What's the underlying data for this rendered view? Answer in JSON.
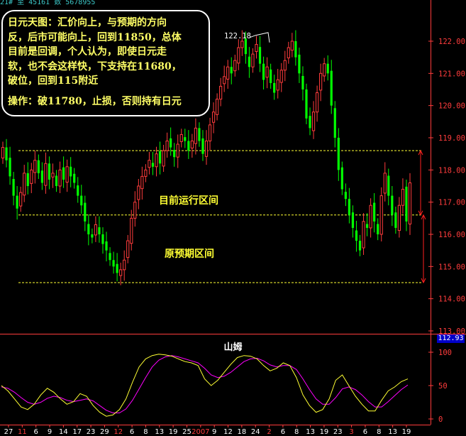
{
  "header_fragment": "21# 至 45161 数 5678955",
  "annotation": {
    "lines": [
      "日元天图：汇价向上，与预期的方向",
      "反，后市可能向上，回到11850，总体",
      "目前是回调，个人认为，即使日元走",
      "软，也不会这样快，下支持在11680，",
      "破位，回到115附近"
    ],
    "operation": "操作：破11780，止损，否则持有日元"
  },
  "zone_labels": {
    "current": "目前运行区间",
    "original": "原预期区间"
  },
  "indicator": {
    "title": "山姆",
    "current_value_box": "112.93",
    "ticks": [
      "100",
      "50",
      "0"
    ]
  },
  "colors": {
    "up": "#ff3c3c",
    "down": "#00ff00",
    "dash": "#ffff33",
    "arrow": "#ff2020",
    "axis": "#ff3c3c",
    "k_line": "#ffff33",
    "d_line": "#ff00ff"
  },
  "chart_data": {
    "type": "candlestick",
    "y_ticks": [
      "122.00",
      "121.00",
      "120.00",
      "119.00",
      "118.00",
      "117.00",
      "116.00",
      "115.00",
      "114.00",
      "113.00"
    ],
    "ylim": [
      113.0,
      122.6
    ],
    "high_annotation": "122.18",
    "support_levels": [
      118.6,
      116.6,
      114.5
    ],
    "x_tick_labels": [
      {
        "t": "27",
        "c": "w"
      },
      {
        "t": "11",
        "c": "r"
      },
      {
        "t": "6",
        "c": "w"
      },
      {
        "t": "9",
        "c": "w"
      },
      {
        "t": "14",
        "c": "w"
      },
      {
        "t": "17",
        "c": "w"
      },
      {
        "t": "23",
        "c": "w"
      },
      {
        "t": "29",
        "c": "w"
      },
      {
        "t": "12",
        "c": "r"
      },
      {
        "t": "6",
        "c": "w"
      },
      {
        "t": "8",
        "c": "w"
      },
      {
        "t": "13",
        "c": "w"
      },
      {
        "t": "19",
        "c": "w"
      },
      {
        "t": "25",
        "c": "w"
      },
      {
        "t": "2007",
        "c": "r"
      },
      {
        "t": "9",
        "c": "w"
      },
      {
        "t": "12",
        "c": "w"
      },
      {
        "t": "18",
        "c": "w"
      },
      {
        "t": "24",
        "c": "w"
      },
      {
        "t": "2",
        "c": "r"
      },
      {
        "t": "6",
        "c": "w"
      },
      {
        "t": "8",
        "c": "w"
      },
      {
        "t": "13",
        "c": "w"
      },
      {
        "t": "19",
        "c": "w"
      },
      {
        "t": "23",
        "c": "w"
      },
      {
        "t": "3",
        "c": "r"
      },
      {
        "t": "6",
        "c": "w"
      },
      {
        "t": "8",
        "c": "w"
      },
      {
        "t": "13",
        "c": "w"
      },
      {
        "t": "19",
        "c": "w"
      }
    ],
    "closes": [
      118.7,
      118.3,
      117.8,
      117.2,
      116.8,
      117.3,
      117.9,
      117.5,
      118.0,
      118.3,
      117.9,
      117.6,
      118.2,
      117.7,
      117.9,
      117.5,
      118.0,
      117.7,
      118.1,
      117.8,
      117.6,
      117.2,
      116.9,
      116.4,
      116.0,
      115.9,
      116.3,
      116.0,
      115.7,
      115.5,
      115.2,
      115.0,
      114.8,
      114.9,
      115.2,
      115.8,
      116.5,
      117.0,
      117.5,
      117.8,
      118.0,
      118.3,
      118.1,
      118.5,
      118.2,
      118.6,
      118.9,
      118.7,
      118.4,
      118.8,
      119.1,
      118.9,
      118.6,
      118.9,
      119.3,
      118.9,
      118.5,
      118.9,
      119.4,
      119.8,
      120.2,
      120.6,
      120.9,
      121.2,
      121.0,
      121.4,
      121.8,
      122.0,
      121.6,
      121.2,
      121.6,
      121.9,
      121.3,
      120.8,
      121.2,
      120.7,
      120.4,
      120.8,
      121.1,
      121.4,
      121.8,
      122.0,
      121.5,
      121.0,
      120.5,
      119.6,
      119.3,
      119.8,
      120.4,
      121.0,
      121.3,
      121.0,
      120.0,
      119.0,
      118.0,
      117.4,
      117.1,
      116.6,
      116.2,
      115.8,
      115.5,
      116.4,
      116.2,
      116.9,
      116.4,
      116.0,
      117.2,
      117.9,
      117.2,
      116.6,
      116.2,
      116.9,
      117.4,
      116.4,
      117.6
    ],
    "sam_k": [
      50,
      42,
      30,
      18,
      14,
      22,
      36,
      46,
      40,
      30,
      22,
      26,
      38,
      34,
      20,
      10,
      4,
      6,
      14,
      30,
      55,
      78,
      90,
      95,
      97,
      96,
      94,
      90,
      86,
      84,
      80,
      60,
      50,
      58,
      70,
      82,
      92,
      95,
      94,
      90,
      80,
      72,
      76,
      84,
      80,
      62,
      36,
      20,
      10,
      14,
      30,
      58,
      66,
      50,
      34,
      22,
      12,
      12,
      28,
      42,
      48,
      56,
      60
    ],
    "sam_d": [
      48,
      46,
      40,
      32,
      25,
      22,
      25,
      31,
      34,
      32,
      28,
      26,
      28,
      30,
      27,
      20,
      13,
      9,
      9,
      15,
      28,
      45,
      62,
      78,
      88,
      93,
      95,
      93,
      90,
      87,
      84,
      76,
      66,
      62,
      64,
      70,
      78,
      86,
      90,
      91,
      87,
      81,
      78,
      80,
      80,
      74,
      60,
      44,
      30,
      22,
      22,
      32,
      45,
      48,
      44,
      36,
      26,
      18,
      18,
      26,
      35,
      44,
      51
    ]
  }
}
